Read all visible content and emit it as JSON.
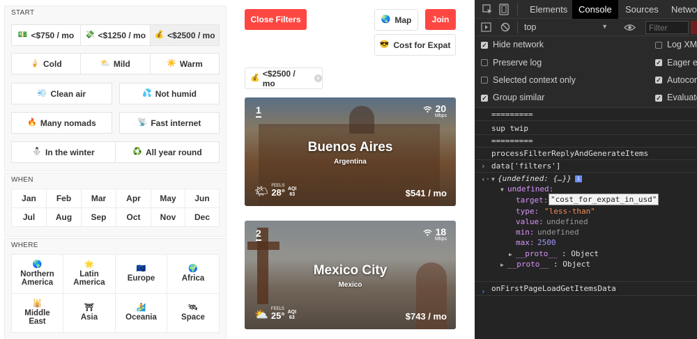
{
  "filters": {
    "start": {
      "title": "START",
      "cost": [
        {
          "icon": "💵",
          "label": "<$750 / mo"
        },
        {
          "icon": "💸",
          "label": "<$1250 / mo"
        },
        {
          "icon": "💰",
          "label": "<$2500 / mo",
          "selected": true
        }
      ],
      "temperature": [
        {
          "icon": "🍦",
          "label": "Cold"
        },
        {
          "icon": "⛅",
          "label": "Mild"
        },
        {
          "icon": "☀️",
          "label": "Warm"
        }
      ],
      "air": [
        {
          "icon": "💨",
          "label": "Clean air"
        },
        {
          "icon": "💦",
          "label": "Not humid"
        }
      ],
      "social": [
        {
          "icon": "🔥",
          "label": "Many nomads"
        },
        {
          "icon": "📡",
          "label": "Fast internet"
        }
      ],
      "season": [
        {
          "icon": "⛄",
          "label": "In the winter"
        },
        {
          "icon": "♻️",
          "label": "All year round"
        }
      ]
    },
    "when": {
      "title": "WHEN",
      "months": [
        "Jan",
        "Feb",
        "Mar",
        "Apr",
        "May",
        "Jun",
        "Jul",
        "Aug",
        "Sep",
        "Oct",
        "Nov",
        "Dec"
      ]
    },
    "where": {
      "title": "WHERE",
      "regions": [
        {
          "icon": "🌎",
          "line1": "Northern",
          "line2": "America"
        },
        {
          "icon": "🌟",
          "line1": "Latin",
          "line2": "America"
        },
        {
          "icon": "🇪🇺",
          "line1": "Europe",
          "line2": ""
        },
        {
          "icon": "🌍",
          "line1": "Africa",
          "line2": ""
        },
        {
          "icon": "🕌",
          "line1": "Middle",
          "line2": "East"
        },
        {
          "icon": "⛩",
          "line1": "Asia",
          "line2": ""
        },
        {
          "icon": "🏄",
          "line1": "Oceania",
          "line2": ""
        },
        {
          "icon": "🛰",
          "line1": "Space",
          "line2": ""
        }
      ]
    }
  },
  "listing": {
    "close_filters": "Close Filters",
    "map": {
      "icon": "🌏",
      "label": "Map"
    },
    "join": "Join",
    "cost_for_expat": {
      "icon": "😎",
      "label": "Cost for Expat"
    },
    "active_chip": {
      "icon": "💰",
      "label": "<$2500 / mo",
      "remove": "×"
    },
    "cards": [
      {
        "rank": "1",
        "wifi_icon": "wifi",
        "speed": "20",
        "speed_unit": "Mbps",
        "city": "Buenos Aires",
        "country": "Argentina",
        "weather_icon": "🌤",
        "feels_label": "FEELS",
        "temp": "28°",
        "aqi_label": "AQI",
        "aqi": "63",
        "price": "$541 / mo"
      },
      {
        "rank": "2",
        "wifi_icon": "wifi",
        "speed": "18",
        "speed_unit": "Mbps",
        "city": "Mexico City",
        "country": "Mexico",
        "weather_icon": "⛅",
        "feels_label": "FEELS",
        "temp": "25°",
        "aqi_label": "AQI",
        "aqi": "63",
        "price": "$743 / mo"
      }
    ]
  },
  "devtools": {
    "tabs": [
      "Elements",
      "Console",
      "Sources",
      "Network"
    ],
    "active_tab": "Console",
    "context": "top",
    "filter_placeholder": "Filter",
    "settings_left": [
      {
        "label": "Hide network",
        "checked": true
      },
      {
        "label": "Preserve log",
        "checked": false
      },
      {
        "label": "Selected context only",
        "checked": false
      },
      {
        "label": "Group similar",
        "checked": true
      }
    ],
    "settings_right": [
      {
        "label": "Log XMLHttpRequests",
        "checked": false
      },
      {
        "label": "Eager evaluation",
        "checked": true
      },
      {
        "label": "Autocomplete from history",
        "checked": true
      },
      {
        "label": "Evaluate triggers user activation",
        "checked": true
      }
    ],
    "console": {
      "sep1": "=========",
      "msg1": "sup twip",
      "sep2": "=========",
      "msg2": "processFilterReplyAndGenerateItems",
      "input": "data['filters']",
      "obj_summary": "{undefined: {…}}",
      "obj_key": "undefined:",
      "target_key": "target:",
      "target_val": "\"cost_for_expat_in_usd\"",
      "type_key": "type:",
      "type_val": "\"less-than\"",
      "value_key": "value:",
      "value_val": "undefined",
      "min_key": "min:",
      "min_val": "undefined",
      "max_key": "max:",
      "max_val": "2500",
      "proto_inner": "__proto__",
      "proto_inner_val": ": Object",
      "proto_outer": "__proto__",
      "proto_outer_val": ": Object",
      "msg3": "onFirstPageLoadGetItemsData"
    }
  }
}
